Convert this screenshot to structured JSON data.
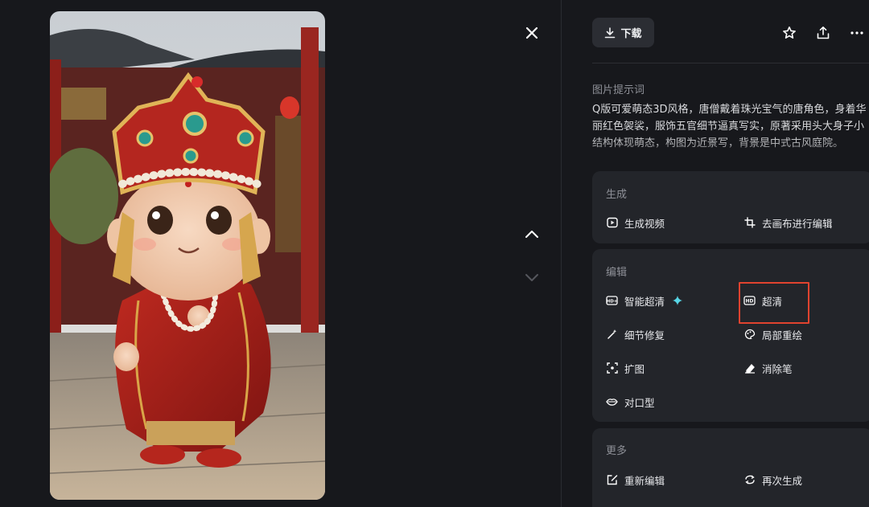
{
  "viewer": {
    "close_icon": "close-icon",
    "prev_icon": "chevron-up-icon",
    "next_icon": "chevron-down-icon"
  },
  "toolbar": {
    "download_label": "下载",
    "icons": [
      "star-icon",
      "share-icon",
      "more-icon"
    ]
  },
  "prompt": {
    "title": "图片提示词",
    "text": "Q版可爱萌态3D风格，唐僧戴着珠光宝气的唐角色，身着华\n丽红色袈裟，服饰五官细节逼真写实，原著采用头大身子小\n结构体现萌态，构图为近景写，背景是中式古风庭院。"
  },
  "sections": {
    "generate": {
      "title": "生成",
      "items": [
        {
          "label": "生成视频",
          "icon": "play-square-icon"
        },
        {
          "label": "去画布进行编辑",
          "icon": "crop-icon"
        }
      ]
    },
    "edit": {
      "title": "编辑",
      "items": [
        {
          "label": "智能超清",
          "icon": "hd-plus-icon",
          "badge_icon": "sparkle-icon"
        },
        {
          "label": "超清",
          "icon": "hd-icon",
          "highlighted": true
        },
        {
          "label": "细节修复",
          "icon": "magic-wand-icon"
        },
        {
          "label": "局部重绘",
          "icon": "palette-icon"
        },
        {
          "label": "扩图",
          "icon": "expand-icon"
        },
        {
          "label": "消除笔",
          "icon": "eraser-icon"
        },
        {
          "label": "对口型",
          "icon": "lips-icon"
        }
      ]
    },
    "more": {
      "title": "更多",
      "items": [
        {
          "label": "重新编辑",
          "icon": "edit-icon"
        },
        {
          "label": "再次生成",
          "icon": "regenerate-icon"
        }
      ]
    }
  },
  "colors": {
    "background": "#17181c",
    "card": "#23252a",
    "highlight": "#e0432f",
    "sparkle": "#57d6e6"
  }
}
